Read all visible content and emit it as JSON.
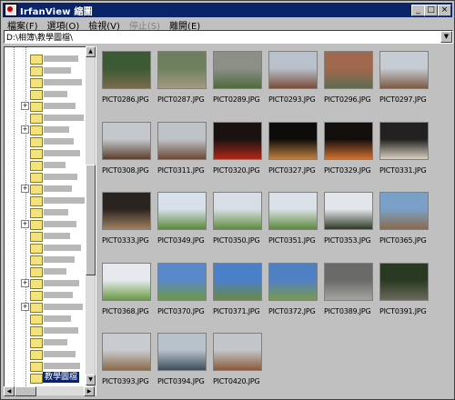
{
  "window": {
    "title": "IrfanView 縮圖"
  },
  "titlebar_buttons": [
    "_",
    "□",
    "×"
  ],
  "menu": [
    {
      "label": "檔案(F)",
      "enabled": true
    },
    {
      "label": "選項(O)",
      "enabled": true
    },
    {
      "label": "檢視(V)",
      "enabled": true
    },
    {
      "label": "停止(S)",
      "enabled": false
    },
    {
      "label": "離開(E)",
      "enabled": true
    }
  ],
  "address": {
    "path": "D:\\相簿\\教學圖檔\\"
  },
  "tree": {
    "selected_label": "教學圖檔"
  },
  "thumbnails": [
    {
      "file": "PICT0286.JPG",
      "c1": "#3c5a34",
      "c2": "#7a6a4c"
    },
    {
      "file": "PICT0287.JPG",
      "c1": "#6e7f5e",
      "c2": "#a59a84"
    },
    {
      "file": "PICT0289.JPG",
      "c1": "#8c8f88",
      "c2": "#4f6b3c"
    },
    {
      "file": "PICT0293.JPG",
      "c1": "#b9c2cc",
      "c2": "#7a4c3a"
    },
    {
      "file": "PICT0296.JPG",
      "c1": "#a0684c",
      "c2": "#5e6c50"
    },
    {
      "file": "PICT0297.JPG",
      "c1": "#c6ccd3",
      "c2": "#7b5a44"
    },
    {
      "file": "PICT0308.JPG",
      "c1": "#c4c7cc",
      "c2": "#5a3e2e"
    },
    {
      "file": "PICT0311.JPG",
      "c1": "#bfc3c8",
      "c2": "#6a4a34"
    },
    {
      "file": "PICT0320.JPG",
      "c1": "#1a1210",
      "c2": "#b02818"
    },
    {
      "file": "PICT0327.JPG",
      "c1": "#0e0c0a",
      "c2": "#c08040"
    },
    {
      "file": "PICT0329.JPG",
      "c1": "#120e0c",
      "c2": "#d07030"
    },
    {
      "file": "PICT0331.JPG",
      "c1": "#222020",
      "c2": "#d8d0c0"
    },
    {
      "file": "PICT0333.JPG",
      "c1": "#2a2420",
      "c2": "#a08060"
    },
    {
      "file": "PICT0349.JPG",
      "c1": "#d8e0ea",
      "c2": "#5a8a3a"
    },
    {
      "file": "PICT0350.JPG",
      "c1": "#d8dee6",
      "c2": "#5f8d3d"
    },
    {
      "file": "PICT0351.JPG",
      "c1": "#dbe1e8",
      "c2": "#5c8a3c"
    },
    {
      "file": "PICT0353.JPG",
      "c1": "#e2e6ea",
      "c2": "#2e3a26"
    },
    {
      "file": "PICT0365.JPG",
      "c1": "#7aa0c8",
      "c2": "#8a6a4c"
    },
    {
      "file": "PICT0368.JPG",
      "c1": "#e6eaee",
      "c2": "#6a9a42"
    },
    {
      "file": "PICT0370.JPG",
      "c1": "#5a88c8",
      "c2": "#6c9a44"
    },
    {
      "file": "PICT0371.JPG",
      "c1": "#4a80c8",
      "c2": "#6a8a44"
    },
    {
      "file": "PICT0372.JPG",
      "c1": "#5080c4",
      "c2": "#7a9a4c"
    },
    {
      "file": "PICT0389.JPG",
      "c1": "#6a6a68",
      "c2": "#a4a4a0"
    },
    {
      "file": "PICT0391.JPG",
      "c1": "#2a3a22",
      "c2": "#6a6a5a"
    },
    {
      "file": "PICT0393.JPG",
      "c1": "#c8ccd0",
      "c2": "#8a6a4a"
    },
    {
      "file": "PICT0394.JPG",
      "c1": "#b8c2cc",
      "c2": "#3e4e5a"
    },
    {
      "file": "PICT0420.JPG",
      "c1": "#c2c6ca",
      "c2": "#8a5a3a"
    }
  ]
}
